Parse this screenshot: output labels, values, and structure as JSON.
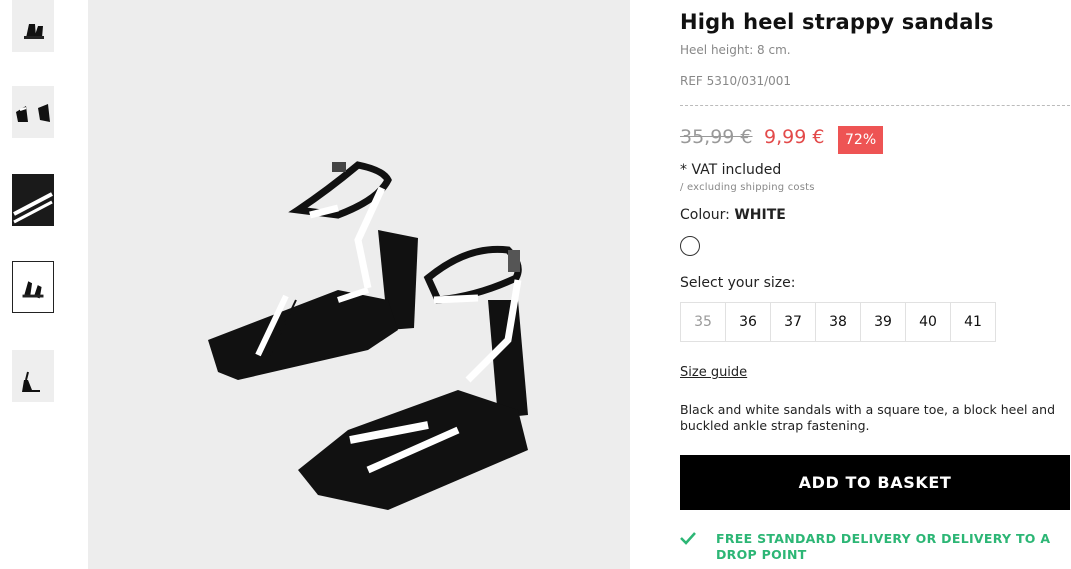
{
  "product": {
    "title": "High heel strappy sandals",
    "heel_height": "Heel height: 8 cm.",
    "ref": "REF 5310/031/001",
    "old_price": "35,99 €",
    "new_price": "9,99 €",
    "discount": "72%",
    "vat": "* VAT included",
    "shipping_note": "/ excluding shipping costs",
    "colour_label": "Colour:",
    "colour_value": "WHITE",
    "size_label": "Select your size:",
    "sizes": [
      "35",
      "36",
      "37",
      "38",
      "39",
      "40",
      "41"
    ],
    "size_guide": "Size guide",
    "description": "Black and white sandals with a square toe, a block heel and buckled ankle strap fastening.",
    "add_to_basket": "ADD TO BASKET",
    "delivery": "FREE STANDARD DELIVERY OR DELIVERY TO A DROP POINT"
  },
  "colors": {
    "accent_red": "#ee5454",
    "delivery_green": "#2cb675",
    "button_black": "#000000"
  },
  "icons": {
    "delivery": "check-icon",
    "swatch": "white-colour-swatch"
  }
}
